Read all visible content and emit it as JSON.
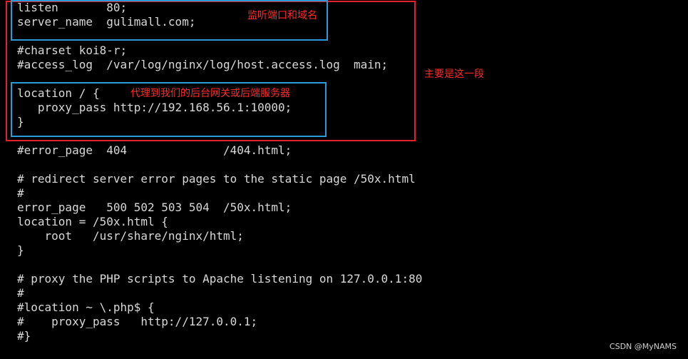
{
  "terminal": {
    "lines": [
      "listen       80;",
      "server_name  gulimall.com;",
      "",
      "#charset koi8-r;",
      "#access_log  /var/log/nginx/log/host.access.log  main;",
      "",
      "location / {",
      "   proxy_pass http://192.168.56.1:10000;",
      "}",
      "",
      "#error_page  404              /404.html;",
      "",
      "# redirect server error pages to the static page /50x.html",
      "#",
      "error_page   500 502 503 504  /50x.html;",
      "location = /50x.html {",
      "    root   /usr/share/nginx/html;",
      "}",
      "",
      "# proxy the PHP scripts to Apache listening on 127.0.0.1:80",
      "#",
      "#location ~ \\.php$ {",
      "#    proxy_pass   http://127.0.0.1;",
      "#}"
    ]
  },
  "annotations": {
    "listen_note": "监听端口和域名",
    "main_note": "主要是这一段",
    "proxy_note": "代理到我们的后台网关或后端服务器"
  },
  "watermark": "CSDN @MyNAMS"
}
